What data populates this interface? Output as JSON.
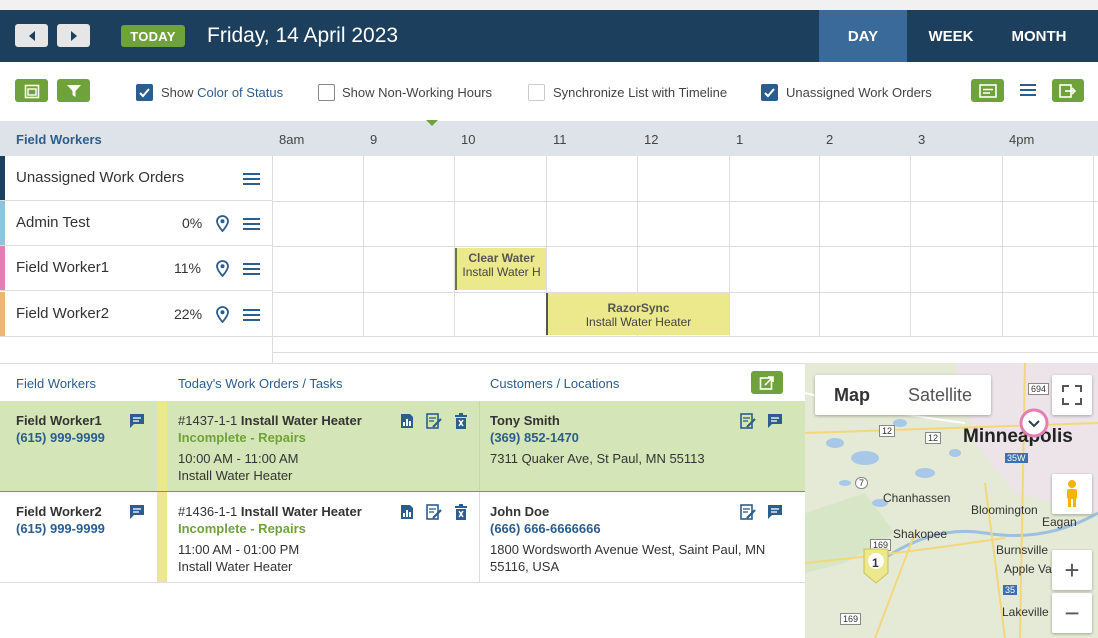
{
  "header": {
    "today_label": "TODAY",
    "date_title": "Friday, 14 April 2023",
    "views": [
      "DAY",
      "WEEK",
      "MONTH"
    ],
    "active_view": "DAY"
  },
  "toolbar": {
    "options": [
      {
        "label_prefix": "Show ",
        "label_highlight": "Color of Status",
        "checked": true
      },
      {
        "label_prefix": "Show Non-Working Hours",
        "label_highlight": "",
        "checked": false
      },
      {
        "label_prefix": "Synchronize List with Timeline",
        "label_highlight": "",
        "checked": false
      },
      {
        "label_prefix": "Unassigned Work Orders",
        "label_highlight": "",
        "checked": true
      }
    ]
  },
  "timeline": {
    "field_workers_header": "Field Workers",
    "hours": [
      "8am",
      "9",
      "10",
      "11",
      "12",
      "1",
      "2",
      "3",
      "4pm"
    ],
    "rows": [
      {
        "name": "Unassigned Work Orders",
        "pct": "",
        "color": "#1c3f5e"
      },
      {
        "name": "Admin Test",
        "pct": "0%",
        "color": "#8fc4dc"
      },
      {
        "name": "Field Worker1",
        "pct": "11%",
        "color": "#e47fb3"
      },
      {
        "name": "Field Worker2",
        "pct": "22%",
        "color": "#e9b778"
      }
    ],
    "blocks": [
      {
        "title": "Clear Water",
        "subtitle": "Install Water H"
      },
      {
        "title": "RazorSync",
        "subtitle": "Install Water Heater"
      }
    ]
  },
  "list": {
    "headers": [
      "Field Workers",
      "Today's Work Orders / Tasks",
      "Customers / Locations"
    ],
    "orders": [
      {
        "worker": "Field Worker1",
        "worker_phone": "(615) 999-9999",
        "wo_id": "#1437-1-1",
        "wo_title": "Install Water Heater",
        "status": "Incomplete - Repairs",
        "time": "10:00 AM - 11:00 AM",
        "task": "Install Water Heater",
        "customer": "Tony Smith",
        "customer_phone": "(369) 852-1470",
        "address": "7311 Quaker Ave, St Paul, MN 55113",
        "address2": ""
      },
      {
        "worker": "Field Worker2",
        "worker_phone": "(615) 999-9999",
        "wo_id": "#1436-1-1",
        "wo_title": "Install Water Heater",
        "status": "Incomplete - Repairs",
        "time": "11:00 AM - 01:00 PM",
        "task": "Install Water Heater",
        "customer": "John Doe",
        "customer_phone": "(666) 666-6666666",
        "address": "1800 Wordsworth Avenue West, Saint Paul, MN",
        "address2": "55116, USA"
      }
    ]
  },
  "map": {
    "type_buttons": [
      "Map",
      "Satellite"
    ],
    "city_major": "Minneapolis",
    "places": [
      "Chanhassen",
      "Bloomington",
      "Eagan",
      "Shakopee",
      "Burnsville",
      "Apple Va",
      "Lakeville"
    ],
    "roads": [
      "694",
      "12",
      "12",
      "35W",
      "7",
      "169",
      "35",
      "169"
    ],
    "cluster_count": "1",
    "zoom_in": "+",
    "zoom_out": "−"
  }
}
